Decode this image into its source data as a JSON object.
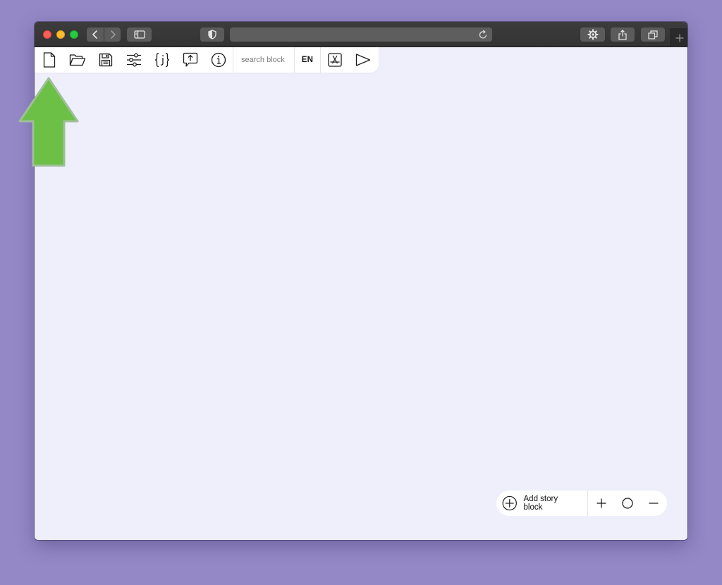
{
  "browser": {
    "traffic_lights": [
      "close",
      "minimize",
      "zoom"
    ],
    "icons": {
      "back": "chevron-left-icon",
      "forward": "chevron-right-icon",
      "sidebar": "sidebar-icon",
      "privacy": "shield-icon",
      "reload": "reload-icon",
      "settings": "gear-icon",
      "share": "share-icon",
      "tabs": "tabs-overview-icon",
      "new_tab": "plus-icon"
    },
    "address": ""
  },
  "toolbar": {
    "tools": [
      {
        "name": "new-file",
        "icon": "new-file-icon"
      },
      {
        "name": "open",
        "icon": "folder-open-icon"
      },
      {
        "name": "save",
        "icon": "save-icon"
      },
      {
        "name": "settings",
        "icon": "sliders-icon"
      },
      {
        "name": "json",
        "icon": "json-icon"
      },
      {
        "name": "upload",
        "icon": "upload-comment-icon"
      },
      {
        "name": "info",
        "icon": "info-icon"
      }
    ],
    "search_placeholder": "search block",
    "language": "EN",
    "app_icon": "app-store-icon",
    "play_icon": "play-icon"
  },
  "bottom_bar": {
    "add_label": "Add story block",
    "add_icon": "add-circle-icon",
    "zoom_in_icon": "plus-icon",
    "zoom_reset_icon": "circle-icon",
    "zoom_out_icon": "minus-icon"
  },
  "annotation": {
    "arrow_icon": "up-arrow-icon",
    "arrow_color": "#6cc046"
  },
  "colors": {
    "background": "#9488c7",
    "canvas": "#efeffb",
    "titlebar": "#383838"
  }
}
